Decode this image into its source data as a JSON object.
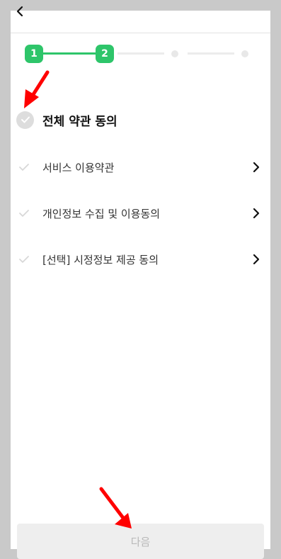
{
  "header": {
    "back_icon": "chevron-left-icon"
  },
  "stepper": {
    "steps": [
      {
        "label": "1",
        "state": "done"
      },
      {
        "label": "2",
        "state": "current"
      },
      {
        "label": "",
        "state": "pending"
      },
      {
        "label": "",
        "state": "pending"
      }
    ],
    "accent_color": "#2ec56a"
  },
  "agree_all": {
    "label": "전체 약관 동의",
    "checked": false
  },
  "terms": [
    {
      "label": "서비스 이용약관"
    },
    {
      "label": "개인정보 수집 및 이용동의"
    },
    {
      "label": "[선택] 시정정보 제공 동의"
    }
  ],
  "next_button": {
    "label": "다음",
    "enabled": false
  },
  "annotation_color": "#ff0000"
}
